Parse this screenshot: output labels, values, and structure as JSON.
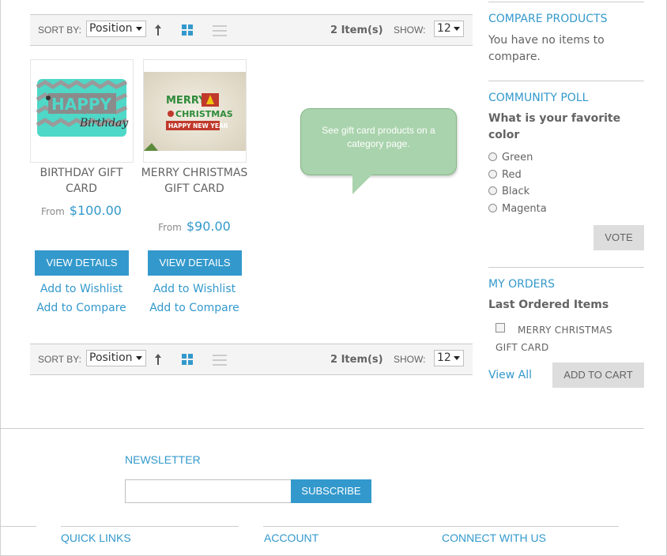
{
  "toolbar": {
    "sort_label": "SORT BY:",
    "sort_value": "Position",
    "item_count": "2 Item(s)",
    "show_label": "SHOW:",
    "show_value": "12"
  },
  "products": [
    {
      "name": "BIRTHDAY GIFT CARD",
      "from": "From",
      "price": "$100.00",
      "view": "VIEW DETAILS",
      "wishlist": "Add to Wishlist",
      "compare": "Add to Compare",
      "image_text_1": "HAPPY",
      "image_text_2": "Birthday"
    },
    {
      "name": "MERRY CHRISTMAS GIFT CARD",
      "from": "From",
      "price": "$90.00",
      "view": "VIEW DETAILS",
      "wishlist": "Add to Wishlist",
      "compare": "Add to Compare",
      "image_text_1": "MERRY",
      "image_text_2": "CHRISTMAS",
      "image_text_3": "HAPPY NEW YEAR"
    }
  ],
  "tooltip": {
    "text": "See gift card products on a category page."
  },
  "sidebar": {
    "compare": {
      "title": "COMPARE PRODUCTS",
      "text": "You have no items to compare."
    },
    "poll": {
      "title": "COMMUNITY POLL",
      "question": "What is your favorite color",
      "options": [
        "Green",
        "Red",
        "Black",
        "Magenta"
      ],
      "vote": "VOTE"
    },
    "orders": {
      "title": "MY ORDERS",
      "subtitle": "Last Ordered Items",
      "item": "MERRY CHRISTMAS GIFT CARD",
      "view_all": "View All",
      "add_to_cart": "ADD TO CART"
    }
  },
  "footer": {
    "newsletter_title": "NEWSLETTER",
    "newsletter_placeholder": "",
    "subscribe": "SUBSCRIBE",
    "quick_links": "QUICK LINKS",
    "account": "ACCOUNT",
    "connect": "CONNECT WITH US"
  },
  "colors": {
    "accent": "#3399cc",
    "tooltip": "#a9d3ac",
    "gray_button": "#dddddd"
  }
}
